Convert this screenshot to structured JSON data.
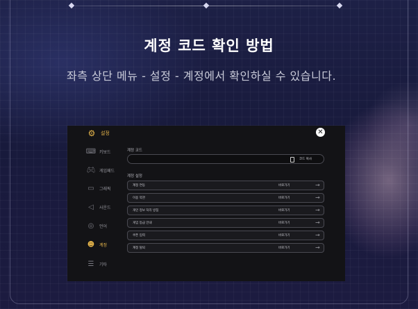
{
  "page": {
    "title": "계정 코드 확인 방법",
    "description": "좌측 상단 메뉴 - 설정 - 계정에서 확인하실 수 있습니다."
  },
  "settings_panel": {
    "header": {
      "label": "설정",
      "icon": "gear-icon"
    },
    "sidebar": [
      {
        "label": "키보드",
        "icon": "keyboard-icon",
        "active": false
      },
      {
        "label": "게임패드",
        "icon": "gamepad-icon",
        "active": false
      },
      {
        "label": "그래픽",
        "icon": "monitor-icon",
        "active": false
      },
      {
        "label": "사운드",
        "icon": "speaker-icon",
        "active": false
      },
      {
        "label": "언어",
        "icon": "globe-icon",
        "active": false
      },
      {
        "label": "계정",
        "icon": "account-icon",
        "active": true
      },
      {
        "label": "기타",
        "icon": "list-icon",
        "active": false
      }
    ],
    "account_code": {
      "label": "계정 코드",
      "value": "",
      "copy_label": "코드 복사"
    },
    "account_settings": {
      "label": "계정 설정",
      "rows": [
        {
          "label": "계정 연동",
          "action": "바로가기"
        },
        {
          "label": "이용 약관",
          "action": "바로가기"
        },
        {
          "label": "개인 정보 처리 방침",
          "action": "바로가기"
        },
        {
          "label": "게임 등급 안내",
          "action": "바로가기"
        },
        {
          "label": "쿠폰 입력",
          "action": "바로가기"
        },
        {
          "label": "계정 탈퇴",
          "action": "바로가기"
        }
      ]
    }
  },
  "colors": {
    "accent": "#e7b64b",
    "panel_bg": "#131316",
    "title": "#ffffff",
    "description": "#c9cbd9"
  }
}
